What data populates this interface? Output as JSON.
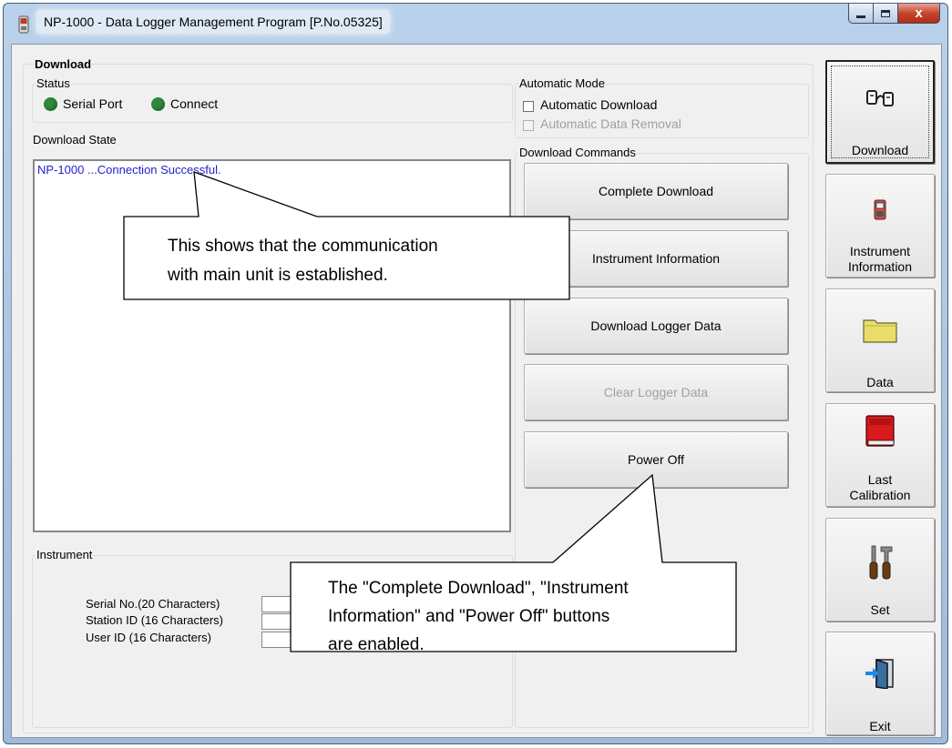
{
  "window": {
    "title": "NP-1000  - Data Logger Management Program [P.No.05325]",
    "controls": {
      "minimize": "–",
      "maximize": "□",
      "close": "x"
    }
  },
  "download_group": {
    "title": "Download",
    "status": {
      "title": "Status",
      "items": [
        {
          "label": "Serial Port",
          "color": "#2c8a3a"
        },
        {
          "label": "Connect",
          "color": "#2c8a3a"
        }
      ]
    },
    "download_state_label": "Download State",
    "log_text": "NP-1000 ...Connection Successful."
  },
  "automatic_mode": {
    "title": "Automatic Mode",
    "automatic_download": {
      "label": "Automatic Download",
      "checked": false,
      "enabled": true
    },
    "automatic_data_removal": {
      "label": "Automatic Data Removal",
      "checked": false,
      "enabled": false
    }
  },
  "download_commands": {
    "title": "Download Commands",
    "buttons": [
      {
        "label": "Complete Download",
        "enabled": true
      },
      {
        "label": "Instrument Information",
        "enabled": true
      },
      {
        "label": "Download Logger Data",
        "enabled": true
      },
      {
        "label": "Clear Logger Data",
        "enabled": false
      },
      {
        "label": "Power Off",
        "enabled": true
      }
    ]
  },
  "instrument": {
    "title": "Instrument",
    "fields": [
      {
        "label": "Serial No.(20 Characters)",
        "value": ""
      },
      {
        "label": "Station ID (16 Characters)",
        "value": ""
      },
      {
        "label": "User ID (16 Characters)",
        "value": ""
      }
    ]
  },
  "nav": {
    "download": {
      "label": "Download",
      "icon": "download-plugs-icon"
    },
    "instrument_info": {
      "line1": "Instrument",
      "line2": "Information",
      "icon": "instrument-icon"
    },
    "data": {
      "label": "Data",
      "icon": "folder-icon"
    },
    "last_calibration": {
      "line1": "Last",
      "line2": "Calibration",
      "icon": "red-book-icon"
    },
    "set": {
      "label": "Set",
      "icon": "tools-icon"
    },
    "exit": {
      "label": "Exit",
      "icon": "exit-door-icon"
    }
  },
  "callouts": {
    "connection": {
      "line1": "This shows that the communication",
      "line2": "with main unit is established."
    },
    "buttons_enabled": {
      "line1": "The \"Complete Download\", \"Instrument",
      "line2": "Information\" and \"Power Off\" buttons",
      "line3": "are enabled."
    }
  }
}
